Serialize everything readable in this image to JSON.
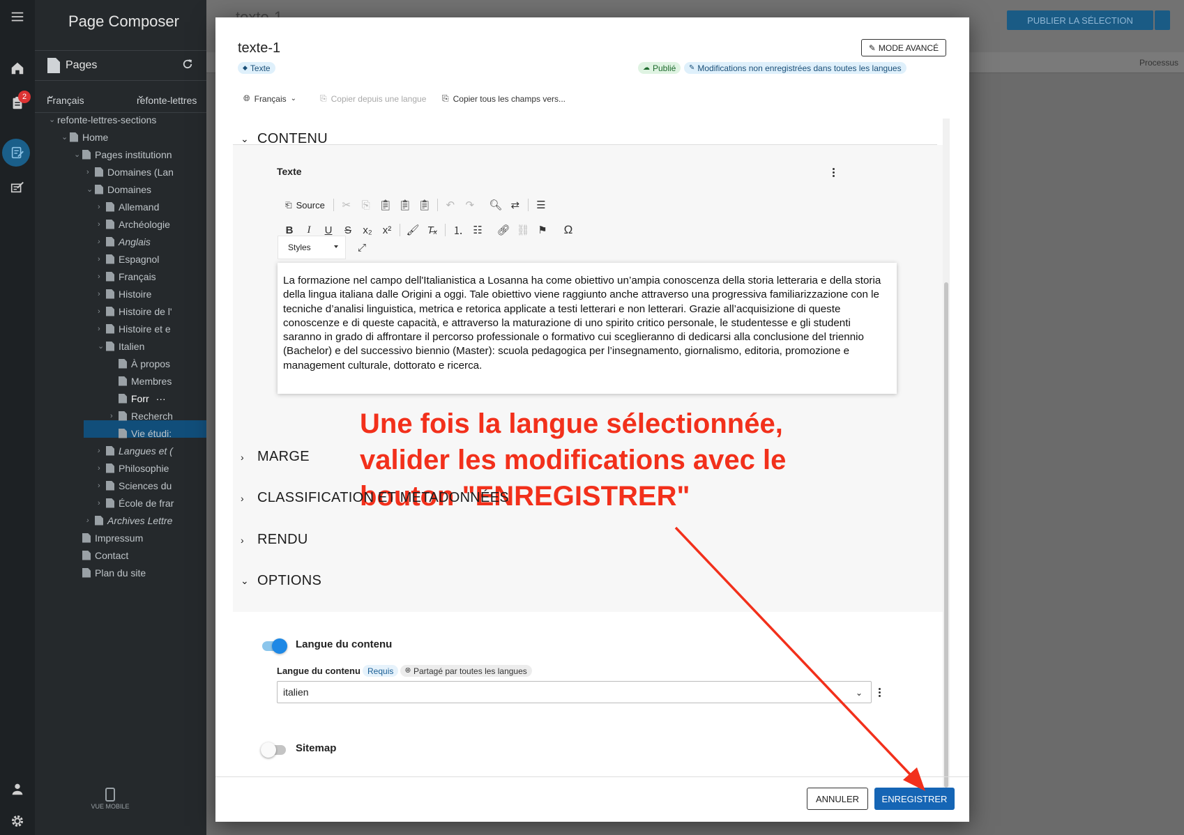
{
  "app": {
    "title": "Page Composer",
    "notification_count": "2",
    "mobile_label": "VUE MOBILE"
  },
  "sidebar": {
    "section_title": "Pages",
    "language": "Français",
    "site": "refonte-lettres",
    "tree": [
      {
        "label": "refonte-lettres-sections",
        "level": 0,
        "chev": "down"
      },
      {
        "label": "Home",
        "level": 1,
        "chev": "down"
      },
      {
        "label": "Pages institutionn",
        "level": 2,
        "chev": "down"
      },
      {
        "label": "Domaines (Lan",
        "level": 3,
        "chev": "right"
      },
      {
        "label": "Domaines",
        "level": 3,
        "chev": "down"
      },
      {
        "label": "Allemand",
        "level": 4,
        "chev": "right"
      },
      {
        "label": "Archéologie",
        "level": 4,
        "chev": "right"
      },
      {
        "label": "Anglais",
        "level": 4,
        "chev": "right",
        "italic": true
      },
      {
        "label": "Espagnol",
        "level": 4,
        "chev": "right"
      },
      {
        "label": "Français",
        "level": 4,
        "chev": "right"
      },
      {
        "label": "Histoire",
        "level": 4,
        "chev": "right"
      },
      {
        "label": "Histoire de l'",
        "level": 4,
        "chev": "right"
      },
      {
        "label": "Histoire et e",
        "level": 4,
        "chev": "right"
      },
      {
        "label": "Italien",
        "level": 4,
        "chev": "down"
      },
      {
        "label": "À propos",
        "level": 5,
        "chev": ""
      },
      {
        "label": "Membres",
        "level": 5,
        "chev": ""
      },
      {
        "label": "Forr",
        "level": 5,
        "chev": "",
        "selected": true
      },
      {
        "label": "Recherch",
        "level": 5,
        "chev": "right"
      },
      {
        "label": "Vie étudi:",
        "level": 5,
        "chev": ""
      },
      {
        "label": "Langues et (",
        "level": 4,
        "chev": "right",
        "italic": true
      },
      {
        "label": "Philosophie",
        "level": 4,
        "chev": "right"
      },
      {
        "label": "Sciences du",
        "level": 4,
        "chev": "right"
      },
      {
        "label": "École de frar",
        "level": 4,
        "chev": "right"
      },
      {
        "label": "Archives Lettre",
        "level": 3,
        "chev": "right",
        "italic": true
      },
      {
        "label": "Impressum",
        "level": 2,
        "chev": ""
      },
      {
        "label": "Contact",
        "level": 2,
        "chev": ""
      },
      {
        "label": "Plan du site",
        "level": 2,
        "chev": ""
      }
    ],
    "selected_more": "···"
  },
  "background": {
    "page_title": "texte-1",
    "publish_label": "PUBLIER LA SÉLECTION",
    "processus_label": "Processus"
  },
  "dialog": {
    "title": "texte-1",
    "advanced_mode": "MODE AVANCÉ",
    "type_chip": "Texte",
    "status_published": "Publié",
    "status_unsaved": "Modifications non enregistrées dans toutes les langues",
    "language_selector": "Français",
    "copy_from_language": "Copier depuis une langue",
    "copy_all_fields": "Copier tous les champs vers...",
    "sections": {
      "contenu": "CONTENU",
      "marge": "MARGE",
      "classification": "CLASSIFICATION ET METADONNÉES",
      "rendu": "RENDU",
      "options": "OPTIONS"
    },
    "text_field_label": "Texte",
    "toolbar": {
      "source": "Source",
      "styles": "Styles"
    },
    "editor_text": "La formazione nel campo dell'Italianistica a Losanna ha come obiettivo un’ampia conoscenza della storia letteraria e della storia della lingua italiana dalle Origini a oggi. Tale obiettivo viene raggiunto anche attraverso una progressiva familiarizzazione con le tecniche d’analisi linguistica, metrica e retorica applicate a testi letterari e non letterari. Grazie all’acquisizione di queste conoscenze e di queste capacità, e attraverso la maturazione di uno spirito critico personale, le studentesse e gli studenti saranno in grado di affrontare il percorso professionale o formativo cui sceglieranno di dedicarsi alla conclusione del triennio (Bachelor) e del successivo biennio (Master): scuola pedagogica per l’insegnamento, giornalismo, editoria, promozione e management culturale, dottorato e ricerca.",
    "annotation": "Une fois la langue sélectionnée, valider les modifications avec le bouton \"ENREGISTRER\"",
    "options": {
      "toggle_language_label": "Langue du contenu",
      "toggle_language_on": true,
      "field_label": "Langue du contenu",
      "required_chip": "Requis",
      "shared_chip": "Partagé par toutes les langues",
      "selected_language": "italien",
      "toggle_sitemap_label": "Sitemap",
      "toggle_sitemap_on": false
    },
    "cancel_label": "ANNULER",
    "save_label": "ENREGISTRER"
  },
  "colors": {
    "accent": "#1565b5",
    "annotation": "#f2301b",
    "sidebar_bg": "#25292c"
  }
}
